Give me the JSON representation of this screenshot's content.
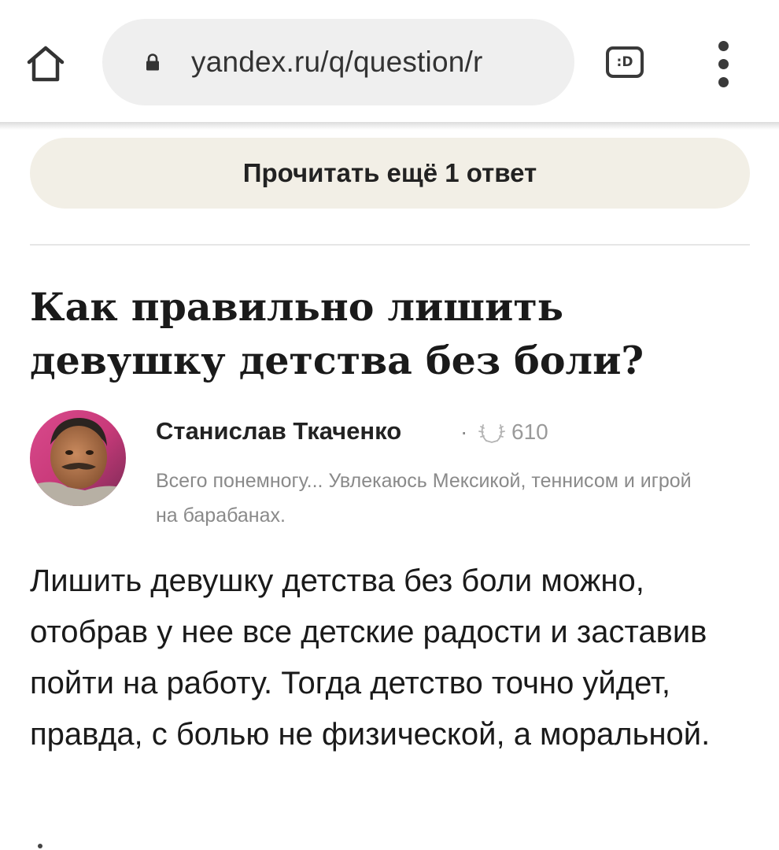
{
  "browser": {
    "url": "yandex.ru/q/question/r",
    "tab_label": ":D",
    "home_icon": "home-icon",
    "lock_icon": "lock-icon",
    "menu_icon": "more-vertical-icon"
  },
  "read_more": {
    "label": "Прочитать ещё 1 ответ"
  },
  "question": {
    "title": "Как правильно лишить девушку детства без боли?"
  },
  "author": {
    "name": "Станислав Ткаченко",
    "separator": "·",
    "rating": "610",
    "rating_icon": "laurel-icon",
    "bio": "Всего понемногу... Увлекаюсь Мексикой, теннисом и игрой на барабанах."
  },
  "answer": {
    "text": "Лишить девушку детства без боли можно, отобрав у нее все детские радости и заставив пойти на работу. Тогда детство точно уйдет, правда, с болью не физической, а моральной."
  },
  "colors": {
    "read_more_bg": "#f2efe6",
    "url_pill_bg": "#efefef",
    "muted_text": "#8a8a8a"
  }
}
